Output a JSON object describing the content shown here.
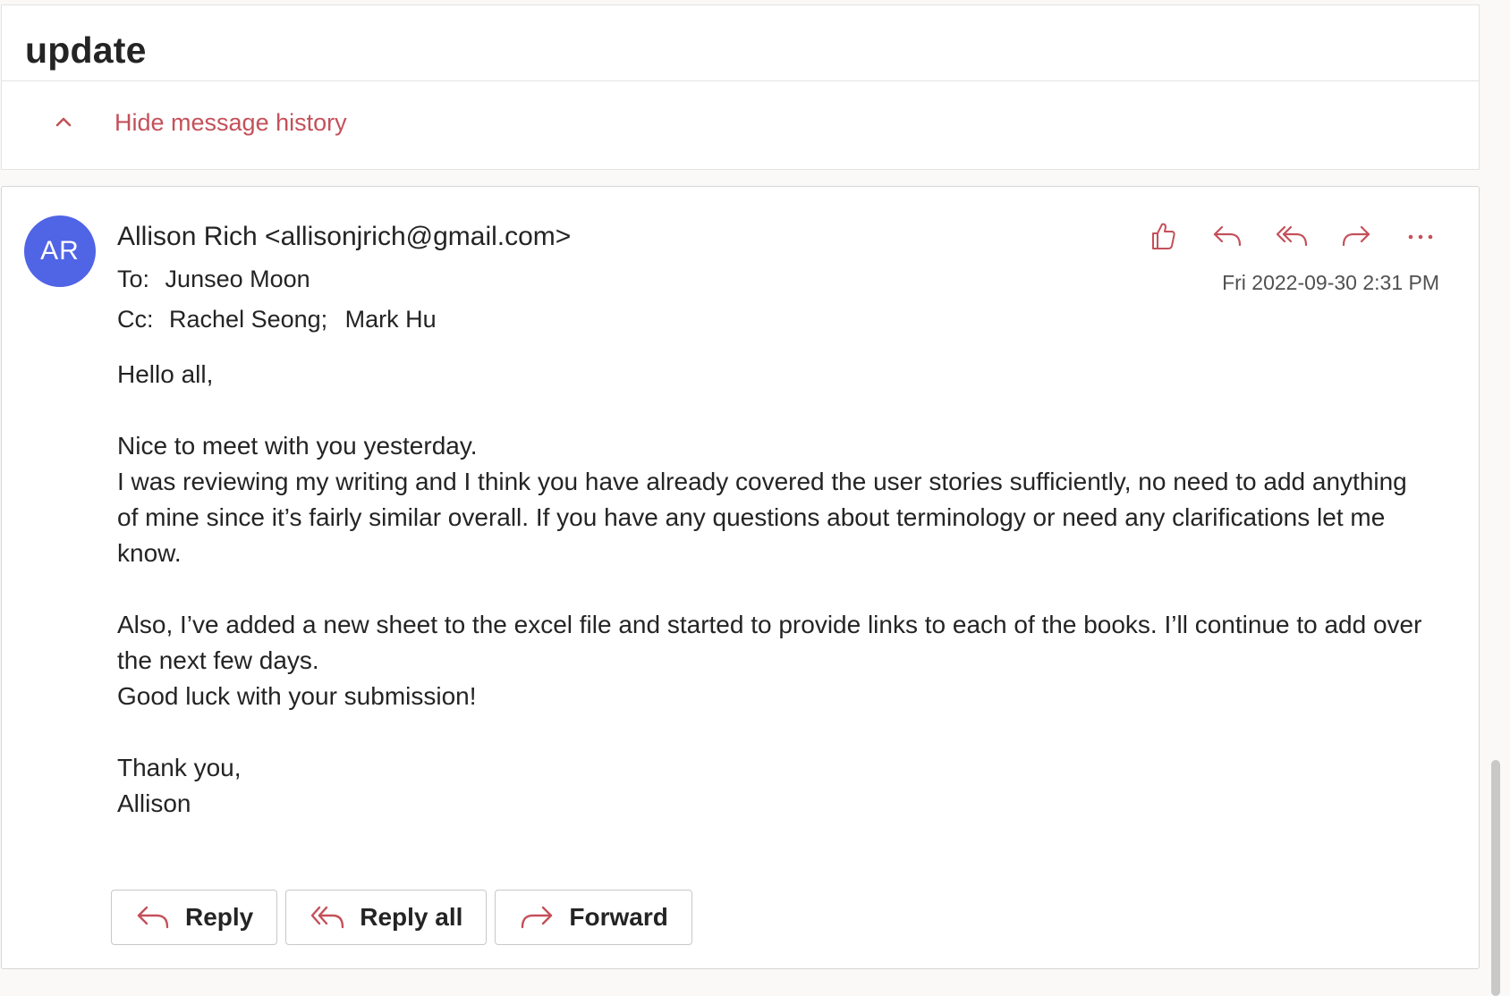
{
  "subject": "update",
  "history": {
    "toggle_label": "Hide message history"
  },
  "message": {
    "avatar_initials": "AR",
    "sender": "Allison Rich <allisonjrich@gmail.com>",
    "to_label": "To:",
    "to": "Junseo Moon",
    "cc_label": "Cc:",
    "cc": [
      "Rachel Seong;",
      "Mark Hu"
    ],
    "timestamp": "Fri 2022-09-30 2:31 PM",
    "body": {
      "greeting": "Hello all,",
      "p1_line1": "Nice to meet with you yesterday.",
      "p1_line2": "I was reviewing my writing and I think you have already covered the user stories sufficiently, no need to add anything of mine since it’s fairly similar overall. If you have any questions about terminology or need any clarifications let me know.",
      "p2_line1": "Also, I’ve added a new sheet to the excel file and started to provide links to each of the books. I’ll continue to add over the next few days.",
      "p2_line2": "Good luck with your submission!",
      "closing": "Thank you,",
      "signature": "Allison"
    },
    "toolbar_icons": [
      "like-icon",
      "reply-icon",
      "reply-all-icon",
      "forward-icon",
      "more-icon"
    ]
  },
  "footer": {
    "reply_label": "Reply",
    "reply_all_label": "Reply all",
    "forward_label": "Forward"
  },
  "colors": {
    "accent": "#c4505a",
    "avatar_bg": "#5064e6",
    "text": "#242424",
    "background": "#faf9f8"
  }
}
